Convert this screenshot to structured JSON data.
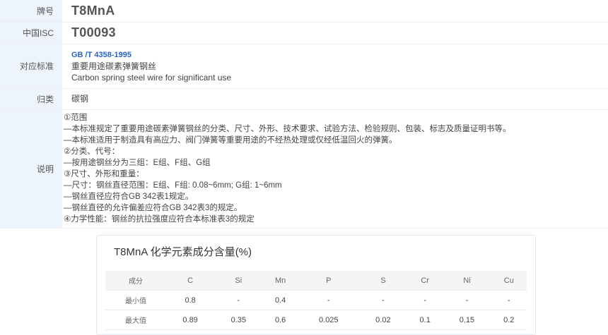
{
  "grade": {
    "label": "牌号",
    "value": "T8MnA"
  },
  "isc": {
    "label": "中国ISC",
    "value": "T00093"
  },
  "standard": {
    "label": "对应标准",
    "code": "GB /T 4358-1995",
    "name_cn": "重要用途碳素弹簧钢丝",
    "name_en": "Carbon spring steel wire for significant use"
  },
  "category": {
    "label": "归类",
    "value": "碳钢"
  },
  "description": {
    "label": "说明",
    "lines": [
      "①范围",
      "—本标准规定了重要用途碳素弹簧钢丝的分类、尺寸、外形、技术要求、试验方法、检验规则、包装、标志及质量证明书等。",
      "—本标准适用于制造具有高应力、阀门弹簧等重要用途的不经热处理或仅经低温回火的弹簧。",
      "②分类、代号：",
      "—按用途钢丝分为三组：E组、F组、G组",
      "③尺寸、外形和重量：",
      "—尺寸：钢丝直径范围：E组、F组: 0.08~6mm; G组: 1~6mm",
      "—钢丝直径应符合GB 342表1规定。",
      "—钢丝直径的允许偏差应符合GB 342表3的规定。",
      "④力学性能：钢丝的抗拉强度应符合本标准表3的规定"
    ]
  },
  "composition": {
    "title": "T8MnA 化学元素成分含量(%)",
    "header": [
      "成分",
      "C",
      "Si",
      "Mn",
      "P",
      "S",
      "Cr",
      "Ni",
      "Cu"
    ],
    "rows": [
      [
        "最小值",
        "0.8",
        "-",
        "0.4",
        "-",
        "-",
        "-",
        "-",
        "-"
      ],
      [
        "最大值",
        "0.89",
        "0.35",
        "0.6",
        "0.025",
        "0.02",
        "0.1",
        "0.15",
        "0.2"
      ]
    ]
  }
}
